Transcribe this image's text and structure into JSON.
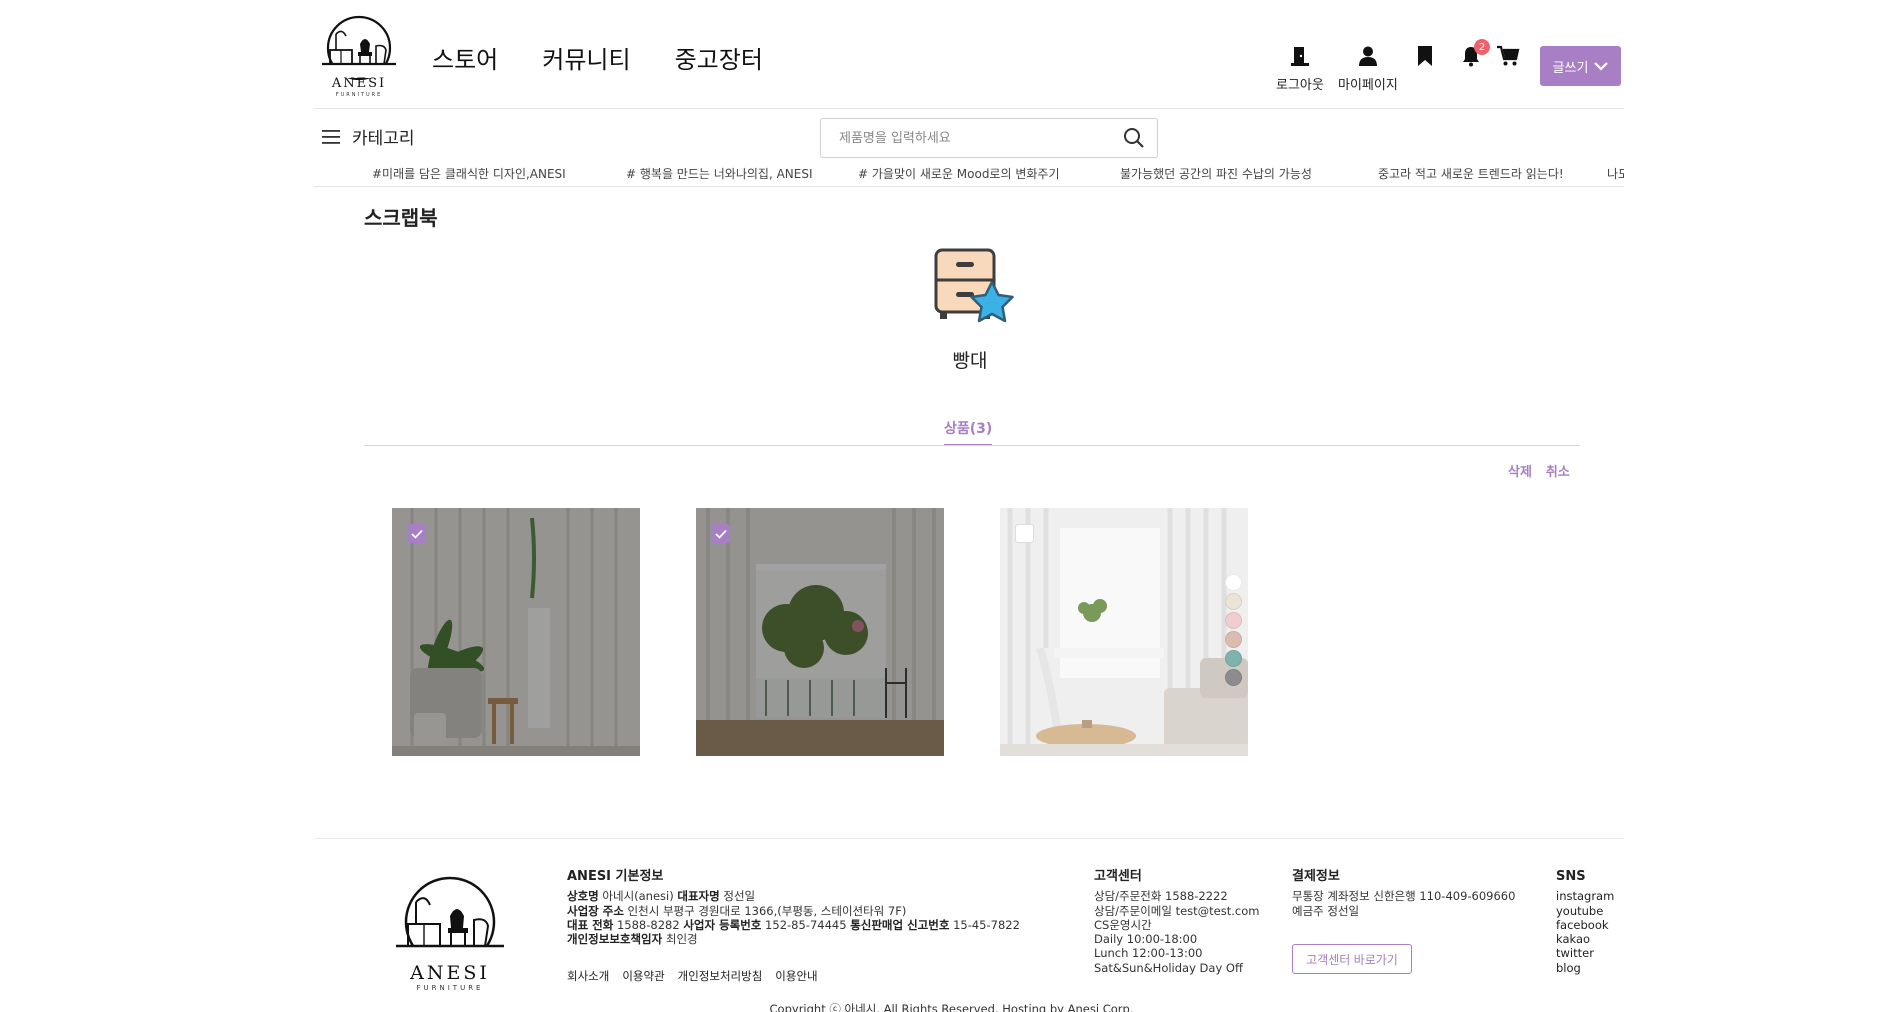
{
  "brand": {
    "name": "ANESI",
    "sub": "FURNITURE"
  },
  "nav": [
    "스토어",
    "커뮤니티",
    "중고장터"
  ],
  "util": {
    "logout": "로그아웃",
    "mypage": "마이페이지",
    "notification_count": "2"
  },
  "write_button": "글쓰기",
  "category_label": "카테고리",
  "search": {
    "placeholder": "제품명을 입력하세요"
  },
  "ticker": [
    "#미래를 담은 클래식한 디자인,ANESI",
    "# 행복을 만드는 너와나의집, ANESI",
    "# 가을맞이 새로운 Mood로의 변화주기",
    "불가능했던 공간의 파진 수납의 가능성",
    "중고라 적고 새로운 트렌드라 읽는다!",
    "나도"
  ],
  "page_title": "스크랩북",
  "folder": {
    "name": "빵대",
    "icon": "drawer-star-icon"
  },
  "tab": {
    "label": "상품(3)"
  },
  "actions": {
    "delete": "삭제",
    "cancel": "취소"
  },
  "products": [
    {
      "checked": true,
      "image": "sheer-curtain-room-with-palm"
    },
    {
      "checked": true,
      "image": "sheer-curtain-window-with-tree"
    },
    {
      "checked": false,
      "image": "white-curtain-living-room",
      "swatches": [
        "#ffffff",
        "#ece3d8",
        "#f1cdd2",
        "#dcbcb0",
        "#7fb1ad",
        "#8c8c8f"
      ]
    }
  ],
  "colors": {
    "accent": "#a87fc5",
    "badge": "#f0626b"
  },
  "footer": {
    "info_title": "ANESI 기본정보",
    "info_lines": [
      {
        "k": "상호명",
        "v": " 아네시(anesi) ",
        "k2": "대표자명",
        "v2": " 정선일"
      },
      {
        "k": "사업장 주소",
        "v": " 인천시 부평구 경원대로 1366,(부평동, 스테이션타워 7F)",
        "k2": "",
        "v2": ""
      },
      {
        "k": "대표 전화",
        "v": " 1588-8282 ",
        "k2": "사업자 등록번호",
        "v2": " 152-85-74445 ",
        "k3": "통신판매업 신고번호",
        "v3": " 15-45-7822"
      },
      {
        "k": "개인정보보호책임자",
        "v": " 최인경",
        "k2": "",
        "v2": ""
      }
    ],
    "links": [
      "회사소개",
      "이용약관",
      "개인정보처리방침",
      "이용안내"
    ],
    "cs_title": "고객센터",
    "cs_lines": [
      "상담/주문전화 1588-2222",
      "상담/주문이메일 test@test.com",
      "CS운영시간",
      "Daily 10:00-18:00",
      "Lunch 12:00-13:00",
      "Sat&Sun&Holiday Day Off"
    ],
    "pay_title": "결제정보",
    "pay_lines": [
      "무통장 계좌정보 신한은행 110-409-609660",
      "예금주 정선일"
    ],
    "cs_button": "고객센터 바로가기",
    "sns_title": "SNS",
    "sns": [
      "instagram",
      "youtube",
      "facebook",
      "kakao",
      "twitter",
      "blog"
    ],
    "copyright": "Copyright ⓒ 아네시. All Rights Reserved. Hosting by Anesi Corp."
  }
}
